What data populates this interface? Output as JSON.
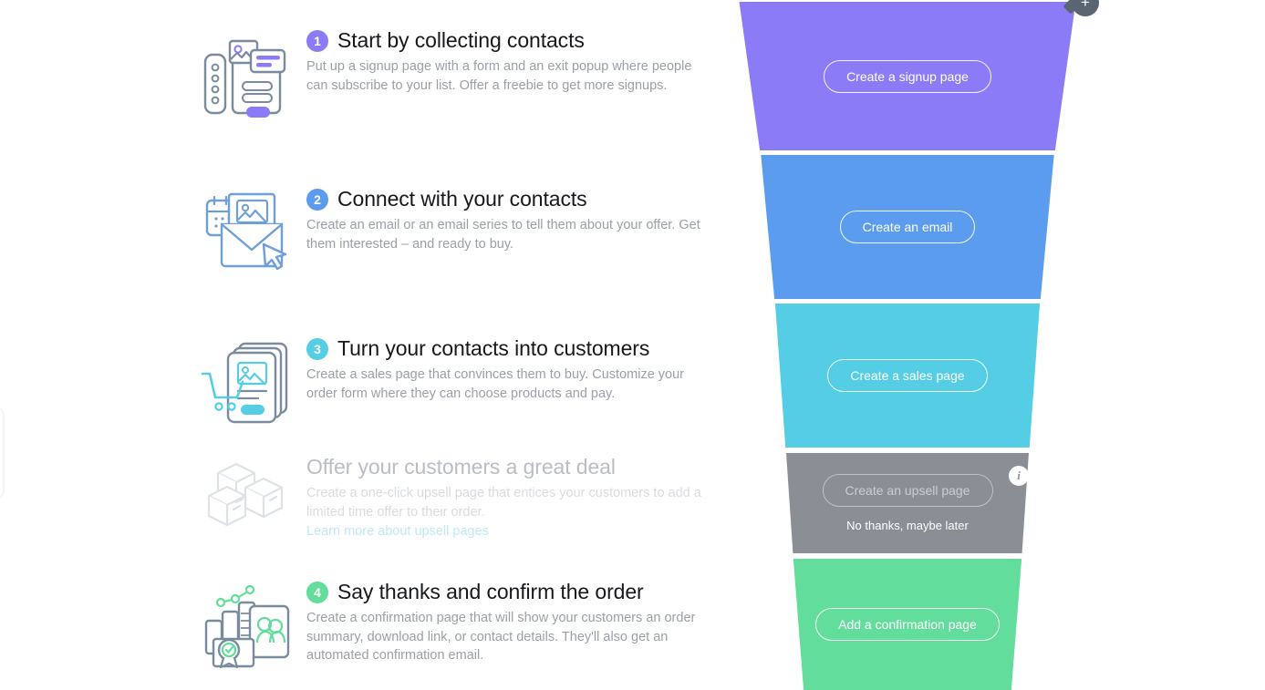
{
  "steps": [
    {
      "number": "1",
      "title": "Start by collecting contacts",
      "description": "Put up a signup page with a form and an exit popup where people can subscribe to your list. Offer a freebie to get more signups.",
      "icon": "signup-page-illustration",
      "color": "#8B7BF7"
    },
    {
      "number": "2",
      "title": "Connect with your contacts",
      "description": "Create an email or an email series to tell them about your offer. Get them interested – and ready to buy.",
      "icon": "email-envelope-illustration",
      "color": "#5C9CEE"
    },
    {
      "number": "3",
      "title": "Turn your contacts into customers",
      "description": "Create a sales page that convinces them to buy. Customize your order form where they can choose products and pay.",
      "icon": "sales-page-cart-illustration",
      "color": "#55CDE4"
    },
    {
      "number": "",
      "title": "Offer your customers a great deal",
      "description": "Create a one-click upsell page that entices your customers to add a limited time offer to their order.",
      "link_label": "Learn more about upsell pages",
      "icon": "upsell-boxes-illustration",
      "color": "#8A8F96"
    },
    {
      "number": "4",
      "title": "Say thanks and confirm the order",
      "description": "Create a confirmation page that will show your customers an order summary, download link, or contact details. They'll also get an automated confirmation email.",
      "icon": "confirmation-chart-illustration",
      "color": "#63DD9B"
    }
  ],
  "funnel": {
    "segments": [
      {
        "name": "signup",
        "button_label": "Create a signup page",
        "color": "#8B7BF7"
      },
      {
        "name": "email",
        "button_label": "Create an email",
        "color": "#5C9CEE"
      },
      {
        "name": "sales",
        "button_label": "Create a sales page",
        "color": "#55CDE4"
      },
      {
        "name": "upsell",
        "button_label": "Create an upsell page",
        "secondary_label": "No thanks, maybe later",
        "info_icon": "info-icon",
        "color": "#8A8F96"
      },
      {
        "name": "confirmation",
        "button_label": "Add a confirmation page",
        "color": "#63DD9B"
      }
    ],
    "add_badge": {
      "icon": "plus-icon",
      "label": "+"
    }
  }
}
